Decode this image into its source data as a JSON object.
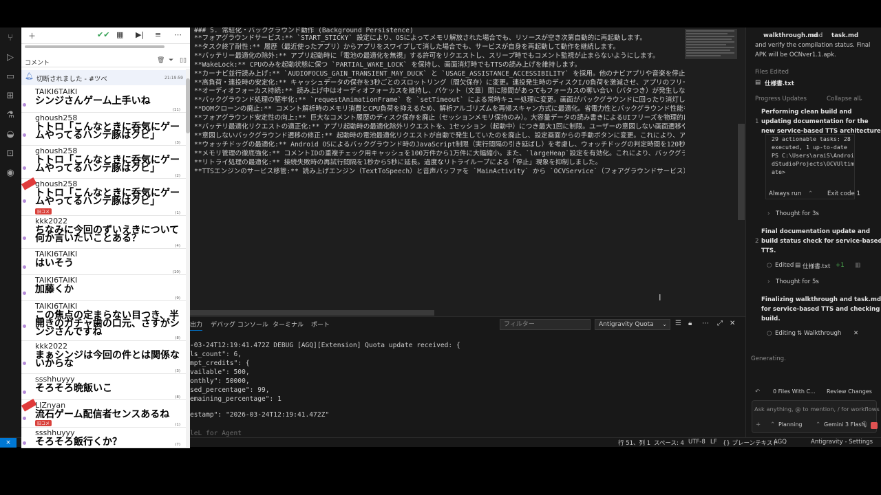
{
  "editor": {
    "lines": [
      "### 5. 常駐化・バックグラウンド動作 (Background Persistence)",
      "**フォアグラウンドサービス:** `START_STICKY` 設定により、OSによってメモリ解放された場合でも、リソースが空き次第自動的に再起動します。",
      "**タスク終了耐性:** 履歴（最近使ったアプリ）からアプリをスワイプして消した場合でも、サービスが自身を再起動して動作を継続します。",
      "**バッテリー最適化の除外:** アプリ起動時に「電池の最適化を無視」する許可をリクエストし、スリープ時でもコメント監視が止まらないようにします。",
      "**WakeLock:** CPUのみを起動状態に保つ `PARTIAL_WAKE_LOCK` を保持し、画面消灯時でもTTSの読み上げを維持します。",
      "**カーナビ並行読み上げ:** `AUDIOFOCUS_GAIN_TRANSIENT_MAY_DUCK` と `USAGE_ASSISTANCE_ACCESSIBILITY` を採用。他のナビアプリや音楽を停止させず、音量",
      "**高負荷・連投時の安定化:** キャッシュデータの保存を3秒ごとのスロットリング（間欠保存）に変更。連投発生時のディスクI/O負荷を激減させ、アプリのフリーズ",
      "**オーディオフォーカス持続:** 読み上げ中はオーディオフォーカスを維持し、パケット（文章）間に隙間があってもフォーカスの奪い合い（バタつき）が発生しない",
      "**バックグラウンド処理の堅牢化:** `requestAnimationFrame` を `setTimeout` による常時キュー処理に変更。画面がバックグラウンドに回ったり消灯したりして",
      "**DOMクローンの廃止:** コメント解析時のメモリ消費とCPU負荷を抑えるため、解析アルゴリズムを再帰スキャン方式に最適化。省電力性とバックグラウンド性能を両",
      "**フォアグラウンド安定性の向上:** 巨大なコメント履歴のディスク保存を廃止（セッションメモリ保持のみ）。大容量データの読み書きによるUIフリーズを物理的に",
      "**バッテリ最適化リクエストの適正化:** アプリ起動時の最適化除外リクエストを、1セッション（起動中）につき最大1回に制限。ユーザーの意図しない画面遷移やバ",
      "**意図しないバックグラウンド遷移の修正:** 起動時の電池最適化リクエストが自動で発生していたのを廃止し、設定画面からの手動ボタンに変更。これにより、アプリ",
      "**ウォッチドッグの最適化:** Android OSによるバックグラウンド時のJavaScript制限（実行間隔の引き延ばし）を考慮し、ウォッチドッグの判定時間を120秒に緩和",
      "**メモリ管理の徹底強化:** コメントIDの重複チェック用キャッシュを100万件から1万件に大幅縮小。また、`largeHeap`設定を有効化。これにより、バックグラウン",
      "**リトライ処理の最適化:** 接続失敗時の再試行間隔を1秒から5秒に延長。過度なリトライループによる「停止」現象を抑制しました。",
      "**TTSエンジンのサービス移管:** 読み上げエンジン（TextToSpeech）と音声バッファを `MainActivity` から `OCVService`（フォアグラウンドサービス）に移管。"
    ]
  },
  "panel": {
    "tabs": [
      "出力",
      "デバッグ コンソール",
      "ターミナル",
      "ポート"
    ],
    "filter_placeholder": "フィルター",
    "source_select": "Antigravity Quota",
    "output": [
      "-03-24T12:19:41.472Z DEBUG [AGQ][Extension] Quota update received: {",
      "ls_count\": 6,",
      "mpt_credits\": {",
      "vailable\": 500,",
      "onthly\": 50000,",
      "sed_percentage\": 99,",
      "emaining_percentage\": 1",
      "",
      "estamp\": \"2026-03-24T12:19:41.472Z\""
    ],
    "agent_input": "leL for Agent"
  },
  "statusbar": {
    "position": "行 51、列 1",
    "spaces": "スペース: 4",
    "encoding": "UTF-8",
    "eol": "LF",
    "language": "{} プレーンテキスト",
    "agq": "AGQ",
    "settings": "Antigravity - Settings"
  },
  "agent": {
    "intro_line1": "walkthrough.md",
    "intro_and": "and",
    "intro_task": "task.md",
    "intro_line2": "and verify the compilation status. Final",
    "intro_line3": "APK will be OCNver1.1.apk.",
    "files_edited_label": "Files Edited",
    "file_edited": "仕様書.txt",
    "progress_label": "Progress Updates",
    "collapse_all": "Collapse all",
    "step1_num": "1",
    "step1_title": [
      "Performing clean build and",
      "updating documentation for the",
      "new service-based TTS architecture."
    ],
    "terminal": [
      "29 actionable tasks: 28",
      "executed, 1 up-to-date",
      "PS C:\\Users\\araiS\\Androi",
      "dStudioProjects\\OCVUltim",
      "ate>"
    ],
    "always_run": "Always run",
    "exit_code": "Exit code 1",
    "thought1": "Thought for 3s",
    "step2_num": "2",
    "step2_title": [
      "Final documentation update and",
      "build status check for service-based",
      "TTS."
    ],
    "edited_label": "Edited",
    "edited_file": "仕様書.txt",
    "edited_delta": "+1",
    "thought2": "Thought for 5s",
    "step3_title": [
      "Finalizing walkthrough and task.md",
      "for service-based TTS and checking",
      "build."
    ],
    "editing_label": "Editing",
    "editing_file": "Walkthrough",
    "generating": "Generating.",
    "files_with_changes": "0 Files With C...",
    "review_changes": "Review Changes",
    "input_placeholder": "Ask anything, @ to mention, / for workflows",
    "mode": "Planning",
    "model": "Gemini 3 Flash"
  },
  "comments": {
    "header_label": "コメント",
    "notice": "切断されました - #ツベ",
    "notice_time": "21:19:59",
    "rows": [
      {
        "user": "TAIKI6TAIKI",
        "msg": "シンジさんゲーム上手いね",
        "count": "(11)",
        "badge": "",
        "new": false
      },
      {
        "user": "ghoush258",
        "msg": "トトロ「こんなときに呑気にゲームやってるハンテ豚はクビ」",
        "count": "(3)",
        "badge": "",
        "new": false
      },
      {
        "user": "ghoush258",
        "msg": "トトロ「こんなときに呑気にゲームやってるハンテ豚はクビ」",
        "count": "(2)",
        "badge": "",
        "new": false
      },
      {
        "user": "ghoush258",
        "msg": "トトロ「こんなときに呑気にゲームやってるハンテ豚はクビ」",
        "count": "(1)",
        "badge": "旧コメ",
        "new": true
      },
      {
        "user": "kkk2022",
        "msg": "ちなみに今回のずいえきについて何か言いたいことある？",
        "count": "(4)",
        "badge": "",
        "new": false
      },
      {
        "user": "TAIKI6TAIKI",
        "msg": "はいそう",
        "count": "(10)",
        "badge": "",
        "new": false
      },
      {
        "user": "TAIKI6TAIKI",
        "msg": "加藤くか",
        "count": "(9)",
        "badge": "",
        "new": false
      },
      {
        "user": "TAIKI6TAIKI",
        "msg": "この焦点の定まらない目つき、半開きのガチャ歯の口元、さすがシンジさんですね",
        "count": "(8)",
        "badge": "",
        "new": false
      },
      {
        "user": "kkk2022",
        "msg": "まぁシンジは今回の件とは関係ないからな",
        "count": "(3)",
        "badge": "",
        "new": false
      },
      {
        "user": "ssshhuyyy",
        "msg": "そろそろ晩飯いこ",
        "count": "(8)",
        "badge": "",
        "new": false
      },
      {
        "user": "LIZnyan",
        "msg": "流石ゲーム配信者センスあるね",
        "count": "(1)",
        "badge": "旧コメ",
        "new": true
      },
      {
        "user": "ssshhuyyy",
        "msg": "そろそろ飯行くか？",
        "count": "(7)",
        "badge": "",
        "new": false
      }
    ]
  },
  "colors": {
    "accent": "#0078d4",
    "badge": "#d9413b",
    "stop": "#e05252"
  }
}
